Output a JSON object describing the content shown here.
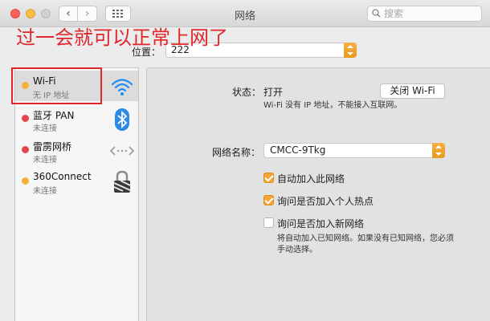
{
  "window": {
    "title": "网络",
    "search_placeholder": "搜索"
  },
  "annotation": "过一会就可以正常上网了",
  "location": {
    "label": "位置：",
    "value": "222"
  },
  "services": [
    {
      "name": "Wi-Fi",
      "status": "无 IP 地址",
      "dot_color": "#f4b13a",
      "icon": "wifi-icon",
      "selected": true
    },
    {
      "name": "蓝牙 PAN",
      "status": "未连接",
      "dot_color": "#e8454a",
      "icon": "bluetooth-icon",
      "selected": false
    },
    {
      "name": "雷雳网桥",
      "status": "未连接",
      "dot_color": "#e8454a",
      "icon": "thunderbolt-bridge-icon",
      "selected": false
    },
    {
      "name": "360Connect",
      "status": "未连接",
      "dot_color": "#f4b13a",
      "icon": "lock-icon",
      "selected": false
    }
  ],
  "detail": {
    "status_label": "状态：",
    "status_value": "打开",
    "toggle_button": "关闭 Wi-Fi",
    "status_desc": "Wi-Fi 没有 IP 地址，不能接入互联网。",
    "network_label": "网络名称：",
    "network_value": "CMCC-9Tkg",
    "options": [
      {
        "label": "自动加入此网络",
        "checked": true
      },
      {
        "label": "询问是否加入个人热点",
        "checked": true
      },
      {
        "label": "询问是否加入新网络",
        "checked": false
      }
    ],
    "options_note_1": "将自动加入已知网络。如果没有已知网络，您必须",
    "options_note_2": "手动选择。"
  },
  "colors": {
    "accent": "#f3a431",
    "annotation": "#e0272b"
  }
}
